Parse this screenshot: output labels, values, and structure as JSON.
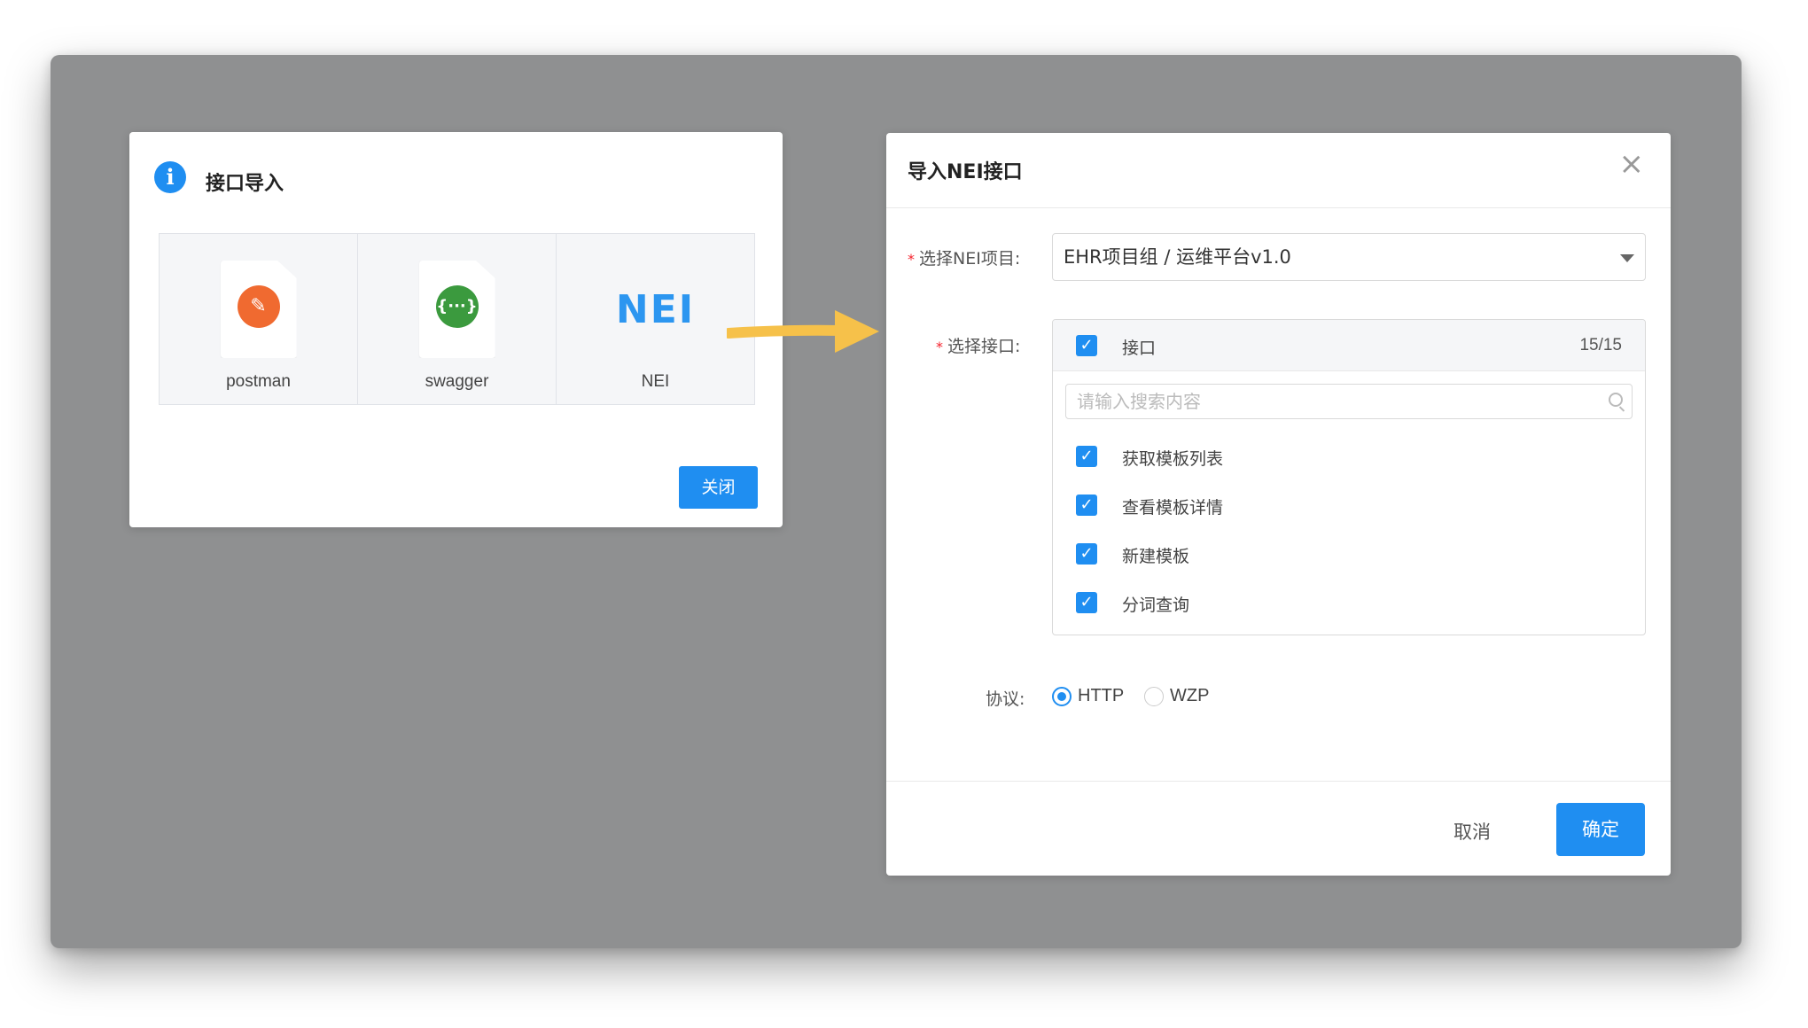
{
  "import_dialog": {
    "title": "接口导入",
    "sources": [
      {
        "label": "postman",
        "icon": "postman-logo-icon"
      },
      {
        "label": "swagger",
        "icon": "swagger-logo-icon"
      },
      {
        "label": "NEI",
        "icon": "nei-logo-icon",
        "logo_text": "NEI"
      }
    ],
    "close_label": "关闭"
  },
  "nei_dialog": {
    "title": "导入NEI接口",
    "project_label": "选择NEI项目:",
    "project_value": "EHR项目组 / 运维平台v1.0",
    "interface_label": "选择接口:",
    "interface_header": "接口",
    "interface_count": "15/15",
    "search_placeholder": "请输入搜索内容",
    "interfaces": [
      "获取模板列表",
      "查看模板详情",
      "新建模板",
      "分词查询"
    ],
    "protocol_label": "协议:",
    "protocols": [
      "HTTP",
      "WZP"
    ],
    "protocol_selected": "HTTP",
    "cancel_label": "取消",
    "ok_label": "确定"
  },
  "colors": {
    "accent": "#1f8ef1",
    "overlay": "#8f9091",
    "arrow": "#f6c14a",
    "required": "#f5222d"
  }
}
